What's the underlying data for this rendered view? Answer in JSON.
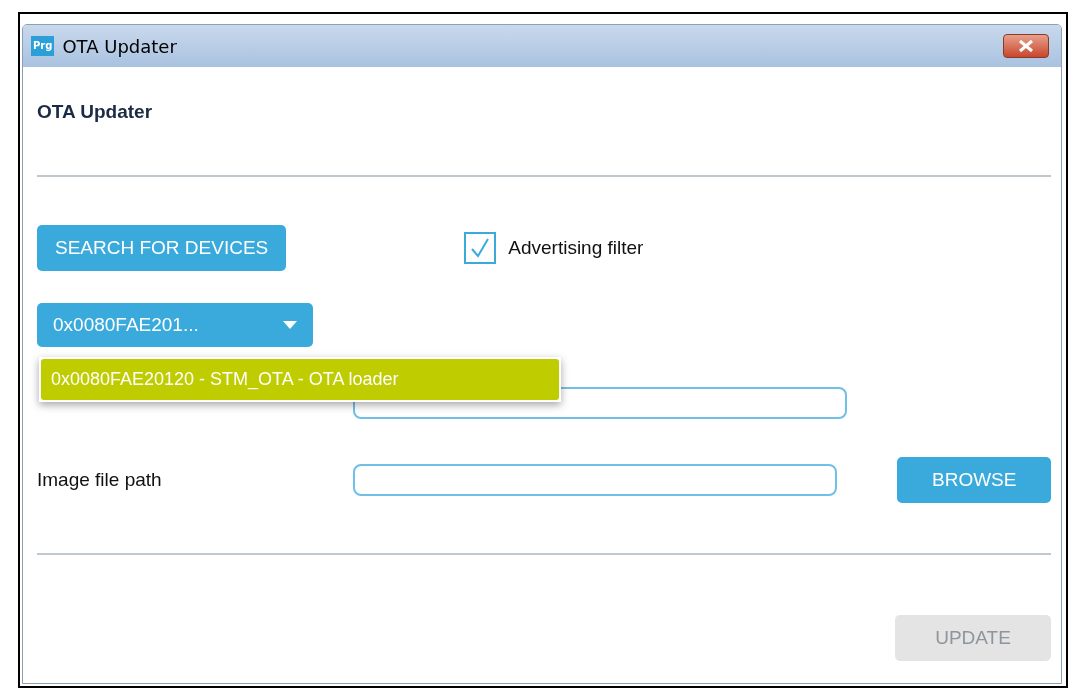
{
  "window": {
    "title": "OTA Updater",
    "app_badge": "Prg"
  },
  "heading": "OTA Updater",
  "search_button": {
    "label": "SEARCH FOR DEVICES"
  },
  "advertising_filter": {
    "label": "Advertising filter",
    "checked": true
  },
  "device_dropdown": {
    "value": "0x0080FAE201...",
    "options": [
      {
        "label": "0x0080FAE20120 - STM_OTA - OTA loader",
        "selected": true
      }
    ]
  },
  "fields": [
    {
      "kind": "covered"
    },
    {
      "kind": "labeled",
      "label": "Image file path",
      "button": "BROWSE"
    }
  ],
  "update_button": {
    "label": "UPDATE",
    "disabled": true
  }
}
